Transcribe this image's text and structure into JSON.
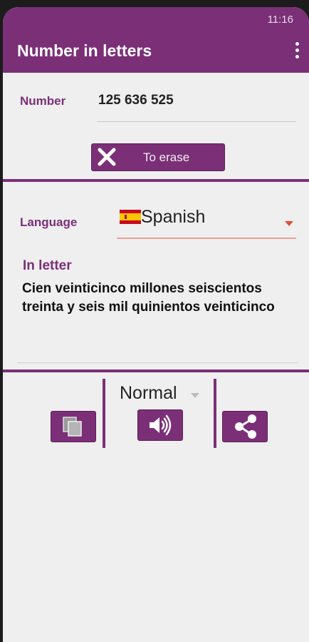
{
  "status_bar": {
    "time": "11:16"
  },
  "app_bar": {
    "title": "Number in letters",
    "menu_icon": "more-vert-icon"
  },
  "input": {
    "label": "Number",
    "value": "125 636 525"
  },
  "erase_button": {
    "label": "To erase",
    "icon": "close-icon"
  },
  "language": {
    "label": "Language",
    "selected": "Spanish",
    "flag_icon": "spain-flag-icon"
  },
  "result": {
    "label": "In letter",
    "text": "Cien veinticinco millones seiscientos treinta y seis mil quinientos veinticinco"
  },
  "speech": {
    "speed": "Normal"
  },
  "actions": {
    "copy_icon": "copy-icon",
    "speak_icon": "speaker-icon",
    "share_icon": "share-icon"
  },
  "colors": {
    "primary": "#7b2f77",
    "background": "#efefef",
    "accent": "#e0503a"
  }
}
